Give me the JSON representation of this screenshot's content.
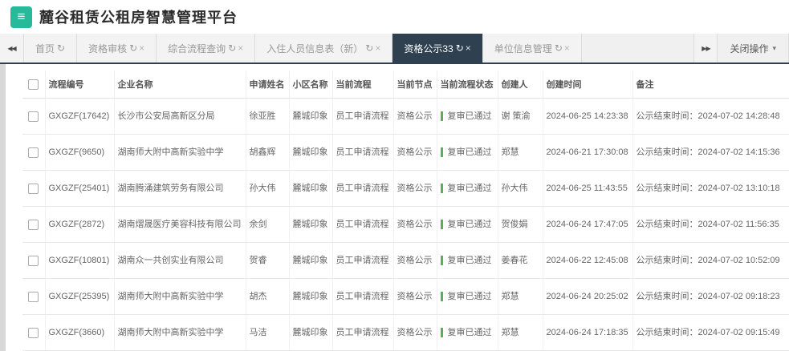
{
  "app": {
    "title": "麓谷租赁公租房智慧管理平台"
  },
  "icons": {
    "hamburger": "≡",
    "refresh": "↻",
    "close": "×",
    "caret": "▾",
    "scroll_left": "◀◀",
    "scroll_right": "▶▶"
  },
  "colors": {
    "brand_green": "#26b99a",
    "active_tab_bg": "#2f4050",
    "status_indicator_green": "#54b254"
  },
  "tabbar": {
    "tabs": [
      {
        "label": "首页",
        "closable": false,
        "active": false
      },
      {
        "label": "资格审核",
        "closable": true,
        "active": false
      },
      {
        "label": "综合流程查询",
        "closable": true,
        "active": false
      },
      {
        "label": "入住人员信息表（新）",
        "closable": true,
        "active": false
      },
      {
        "label": "资格公示33",
        "closable": true,
        "active": true
      },
      {
        "label": "单位信息管理",
        "closable": true,
        "active": false
      }
    ],
    "close_menu_label": "关闭操作"
  },
  "table": {
    "headers": [
      "流程编号",
      "企业名称",
      "申请姓名",
      "小区名称",
      "当前流程",
      "当前节点",
      "当前流程状态",
      "创建人",
      "创建时间",
      "备注"
    ],
    "rows": [
      {
        "checked": false,
        "id": "GXGZF(17642)",
        "company": "长沙市公安局高新区分局",
        "applicant": "徐亚胜",
        "community": "麓城印象",
        "flow": "员工申请流程",
        "node": "资格公示",
        "status": "复审已通过",
        "creator": "谢 策渝",
        "created": "2024-06-25 14:23:38",
        "remark": "公示结束时间：2024-07-02 14:28:48"
      },
      {
        "checked": false,
        "id": "GXGZF(9650)",
        "company": "湖南师大附中高新实验中学",
        "applicant": "胡鑫辉",
        "community": "麓城印象",
        "flow": "员工申请流程",
        "node": "资格公示",
        "status": "复审已通过",
        "creator": "郑慧",
        "created": "2024-06-21 17:30:08",
        "remark": "公示结束时间：2024-07-02 14:15:36"
      },
      {
        "checked": false,
        "id": "GXGZF(25401)",
        "company": "湖南腾涌建筑劳务有限公司",
        "applicant": "孙大伟",
        "community": "麓城印象",
        "flow": "员工申请流程",
        "node": "资格公示",
        "status": "复审已通过",
        "creator": "孙大伟",
        "created": "2024-06-25 11:43:55",
        "remark": "公示结束时间：2024-07-02 13:10:18"
      },
      {
        "checked": false,
        "id": "GXGZF(2872)",
        "company": "湖南熠晟医疗美容科技有限公司",
        "applicant": "余剑",
        "community": "麓城印象",
        "flow": "员工申请流程",
        "node": "资格公示",
        "status": "复审已通过",
        "creator": "贺俊娟",
        "created": "2024-06-24 17:47:05",
        "remark": "公示结束时间：2024-07-02 11:56:35"
      },
      {
        "checked": false,
        "id": "GXGZF(10801)",
        "company": "湖南众一共创实业有限公司",
        "applicant": "贺睿",
        "community": "麓城印象",
        "flow": "员工申请流程",
        "node": "资格公示",
        "status": "复审已通过",
        "creator": "姜春花",
        "created": "2024-06-22 12:45:08",
        "remark": "公示结束时间：2024-07-02 10:52:09"
      },
      {
        "checked": false,
        "id": "GXGZF(25395)",
        "company": "湖南师大附中高新实验中学",
        "applicant": "胡杰",
        "community": "麓城印象",
        "flow": "员工申请流程",
        "node": "资格公示",
        "status": "复审已通过",
        "creator": "郑慧",
        "created": "2024-06-24 20:25:02",
        "remark": "公示结束时间：2024-07-02 09:18:23"
      },
      {
        "checked": false,
        "id": "GXGZF(3660)",
        "company": "湖南师大附中高新实验中学",
        "applicant": "马洁",
        "community": "麓城印象",
        "flow": "员工申请流程",
        "node": "资格公示",
        "status": "复审已通过",
        "creator": "郑慧",
        "created": "2024-06-24 17:18:35",
        "remark": "公示结束时间：2024-07-02 09:15:49"
      }
    ]
  }
}
